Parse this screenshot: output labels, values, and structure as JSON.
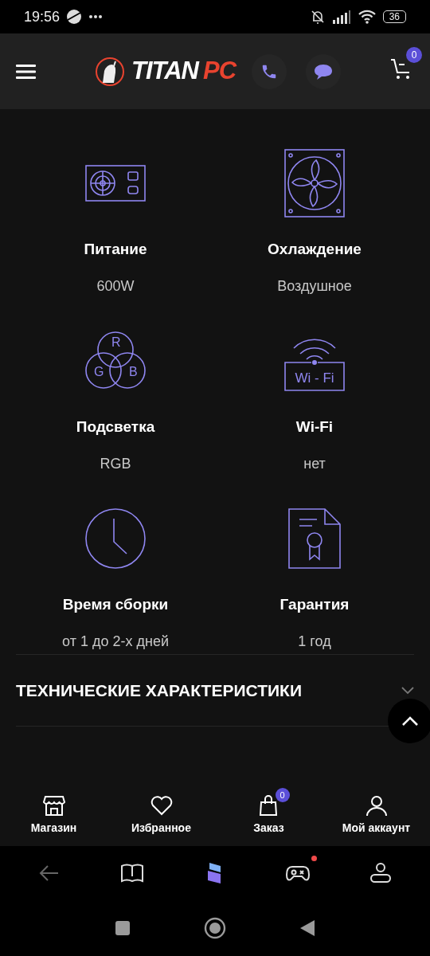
{
  "status_bar": {
    "time": "19:56",
    "battery": "36"
  },
  "header": {
    "logo": {
      "main": "TITAN",
      "accent": "PC"
    },
    "cart_count": "0"
  },
  "specs": [
    {
      "kind": "psu",
      "title": "Питание",
      "value": "600W"
    },
    {
      "kind": "fan",
      "title": "Охлаждение",
      "value": "Воздушное"
    },
    {
      "kind": "rgb",
      "title": "Подсветка",
      "value": "RGB",
      "icon_letters": [
        "R",
        "G",
        "B"
      ]
    },
    {
      "kind": "wifi",
      "title": "Wi-Fi",
      "value": "нет",
      "icon_text": "Wi - Fi"
    },
    {
      "kind": "clock",
      "title": "Время сборки",
      "value": "от 1 до 2-х дней"
    },
    {
      "kind": "certificate",
      "title": "Гарантия",
      "value": "1 год"
    }
  ],
  "section": {
    "title": "ТЕХНИЧЕСКИЕ ХАРАКТЕРИСТИКИ",
    "expanded": false
  },
  "bottom_nav": [
    {
      "kind": "shop",
      "label": "Магазин"
    },
    {
      "kind": "heart",
      "label": "Избранное"
    },
    {
      "kind": "bag",
      "label": "Заказ",
      "badge": "0"
    },
    {
      "kind": "user",
      "label": "Мой аккаунт"
    }
  ],
  "browser_bar": [
    {
      "kind": "back"
    },
    {
      "kind": "book"
    },
    {
      "kind": "app"
    },
    {
      "kind": "gamepad",
      "notification": true
    },
    {
      "kind": "profile"
    }
  ]
}
